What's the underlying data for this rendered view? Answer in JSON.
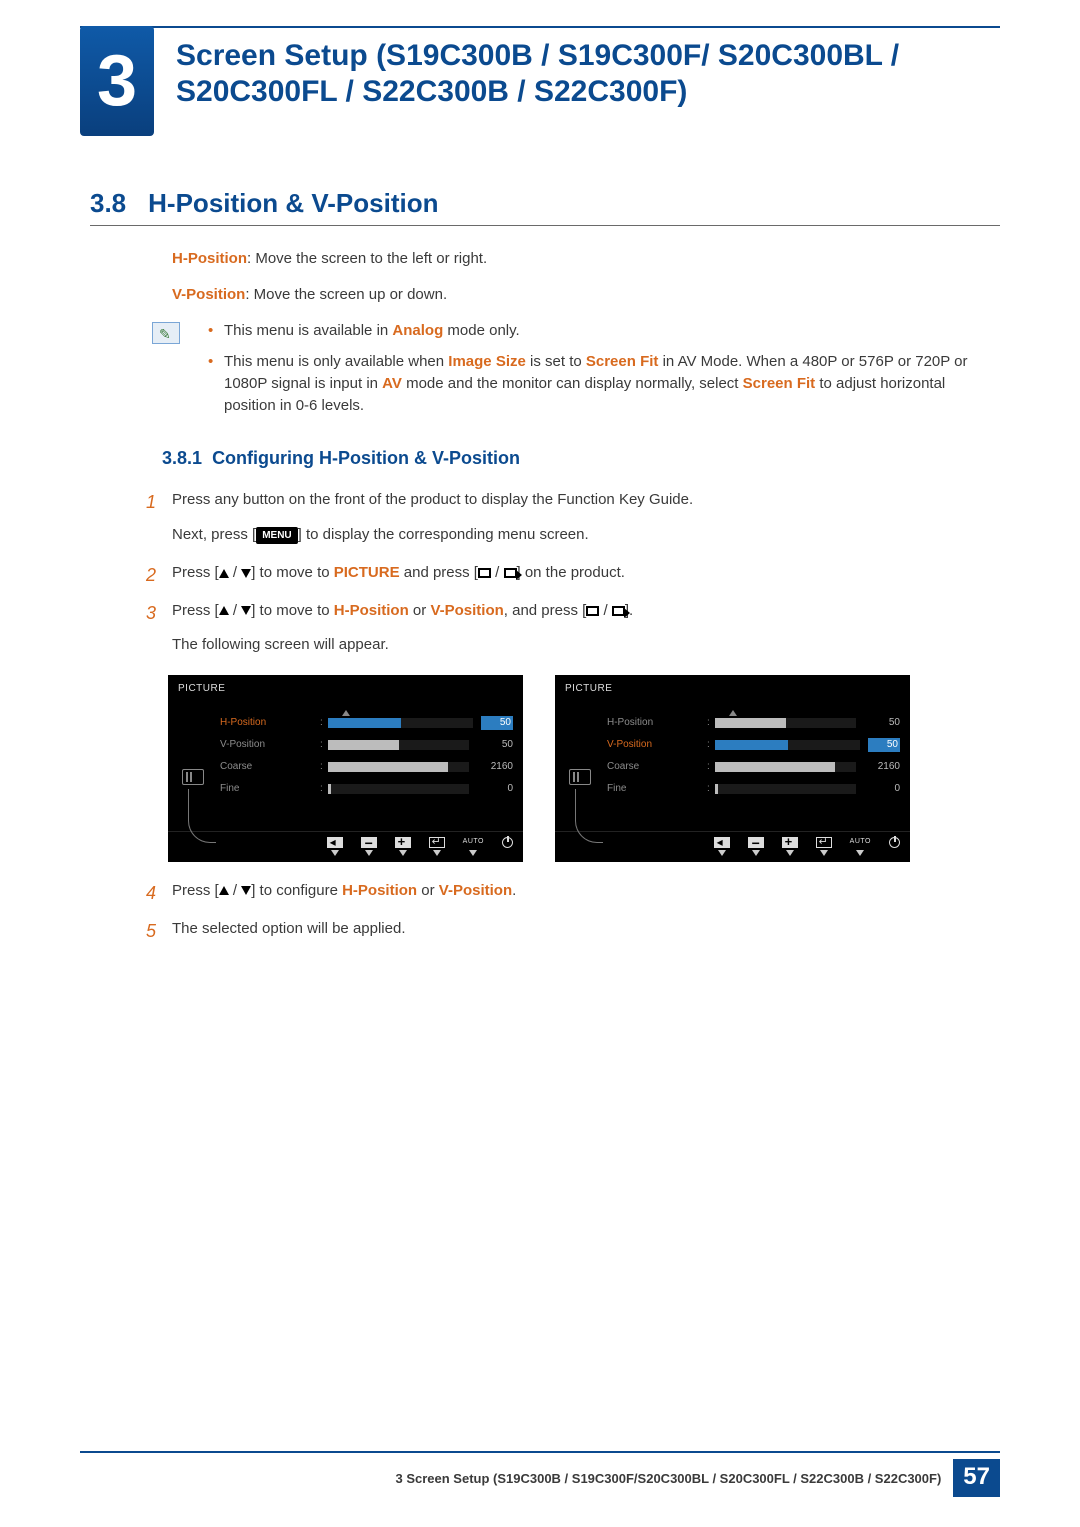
{
  "chapter": {
    "number": "3",
    "title": "Screen Setup (S19C300B / S19C300F/ S20C300BL / S20C300FL / S22C300B / S22C300F)"
  },
  "section": {
    "number": "3.8",
    "title": "H-Position & V-Position"
  },
  "defs": {
    "h_label": "H-Position",
    "h_text": ": Move the screen to the left or right.",
    "v_label": "V-Position",
    "v_text": ": Move the screen up or down."
  },
  "notes": {
    "b1_a": "This menu is available in ",
    "b1_b": "Analog",
    "b1_c": " mode only.",
    "b2_a": "This menu is only available when ",
    "b2_b": "Image Size",
    "b2_c": " is set to ",
    "b2_d": "Screen Fit",
    "b2_e": " in AV Mode. When a 480P or 576P or 720P or 1080P signal is input in ",
    "b2_f": "AV",
    "b2_g": " mode and the monitor can display normally, select ",
    "b2_h": "Screen Fit",
    "b2_i": " to adjust horizontal position in 0-6 levels."
  },
  "sub": {
    "number": "3.8.1",
    "title": "Configuring H-Position & V-Position"
  },
  "steps": {
    "s1a": "Press any button on the front of the product to display the Function Key Guide.",
    "s1b_a": "Next, press [",
    "s1b_menu": "MENU",
    "s1b_b": "] to display the corresponding menu screen.",
    "s2_a": "Press [",
    "s2_b": "] to move to ",
    "s2_c": "PICTURE",
    "s2_d": " and press [",
    "s2_e": "] on the product.",
    "s3_a": "Press [",
    "s3_b": "] to move to ",
    "s3_c": "H-Position",
    "s3_or": " or ",
    "s3_d": "V-Position",
    "s3_e": ", and press [",
    "s3_f": "].",
    "s3_g": "The following screen will appear.",
    "s4_a": "Press [",
    "s4_b": "] to configure ",
    "s4_c": "H-Position",
    "s4_d": " or ",
    "s4_e": "V-Position",
    "s4_f": ".",
    "s5": "The selected option will be applied."
  },
  "osd": {
    "title": "PICTURE",
    "items": [
      {
        "label": "H-Position",
        "value": "50",
        "fill": 50
      },
      {
        "label": "V-Position",
        "value": "50",
        "fill": 50
      },
      {
        "label": "Coarse",
        "value": "2160",
        "fill": 85
      },
      {
        "label": "Fine",
        "value": "0",
        "fill": 2
      }
    ],
    "left_selected": 0,
    "right_selected": 1,
    "auto": "AUTO"
  },
  "footer": {
    "text": "3 Screen Setup (S19C300B / S19C300F/S20C300BL / S20C300FL / S22C300B / S22C300F)",
    "page": "57"
  }
}
